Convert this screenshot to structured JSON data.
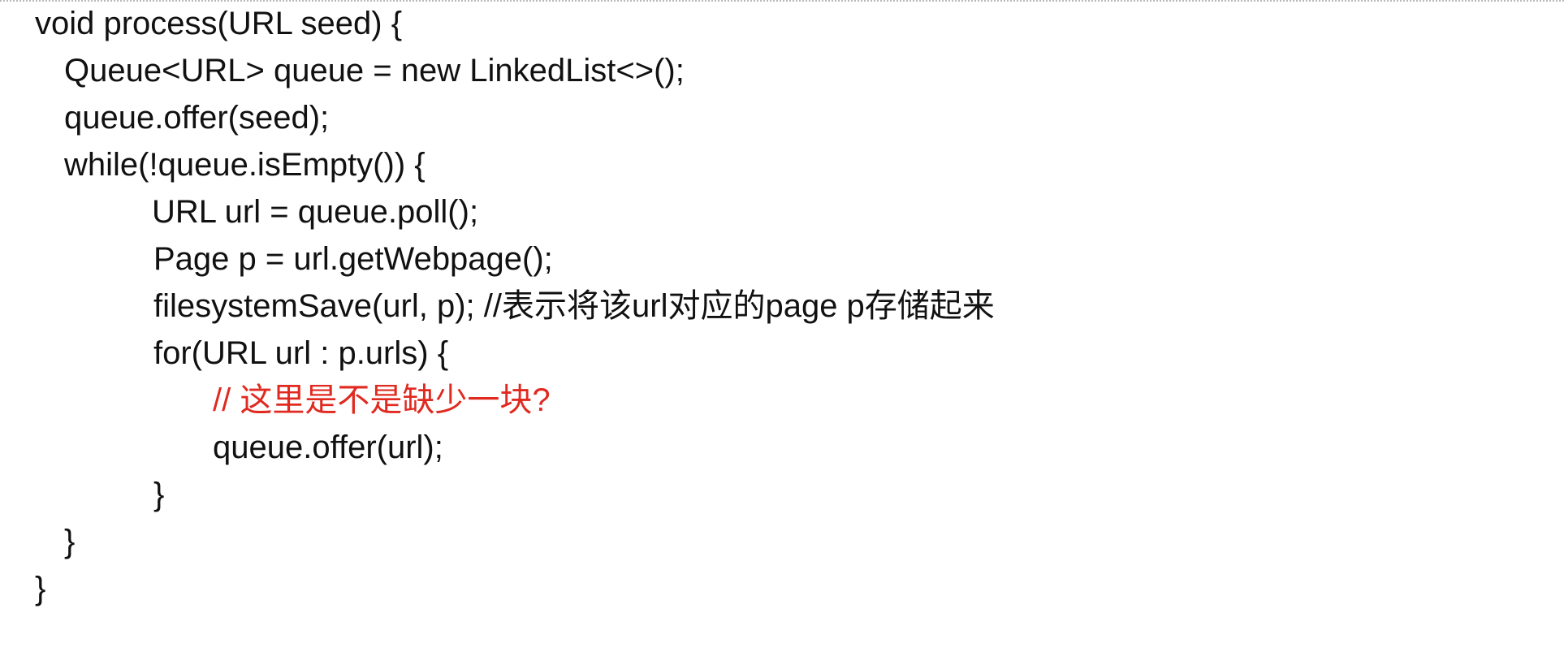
{
  "code": {
    "lines": [
      {
        "text": "void process(URL seed) {",
        "color": "#111111"
      },
      {
        "text": "Queue<URL> queue = new LinkedList<>();",
        "color": "#111111"
      },
      {
        "text": "queue.offer(seed);",
        "color": "#111111"
      },
      {
        "text": "while(!queue.isEmpty()) {",
        "color": "#111111"
      },
      {
        "text": "URL url = queue.poll();",
        "color": "#111111"
      },
      {
        "text": "Page p = url.getWebpage();",
        "color": "#111111"
      },
      {
        "text": "filesystemSave(url, p); //表示将该url对应的page p存储起来",
        "color": "#111111"
      },
      {
        "text": "for(URL url : p.urls) {",
        "color": "#111111"
      },
      {
        "text": "// 这里是不是缺少一块?",
        "color": "#e02a20"
      },
      {
        "text": "queue.offer(url);",
        "color": "#111111"
      },
      {
        "text": "}",
        "color": "#111111"
      },
      {
        "text": "}",
        "color": "#111111"
      },
      {
        "text": "}",
        "color": "#111111"
      }
    ]
  }
}
